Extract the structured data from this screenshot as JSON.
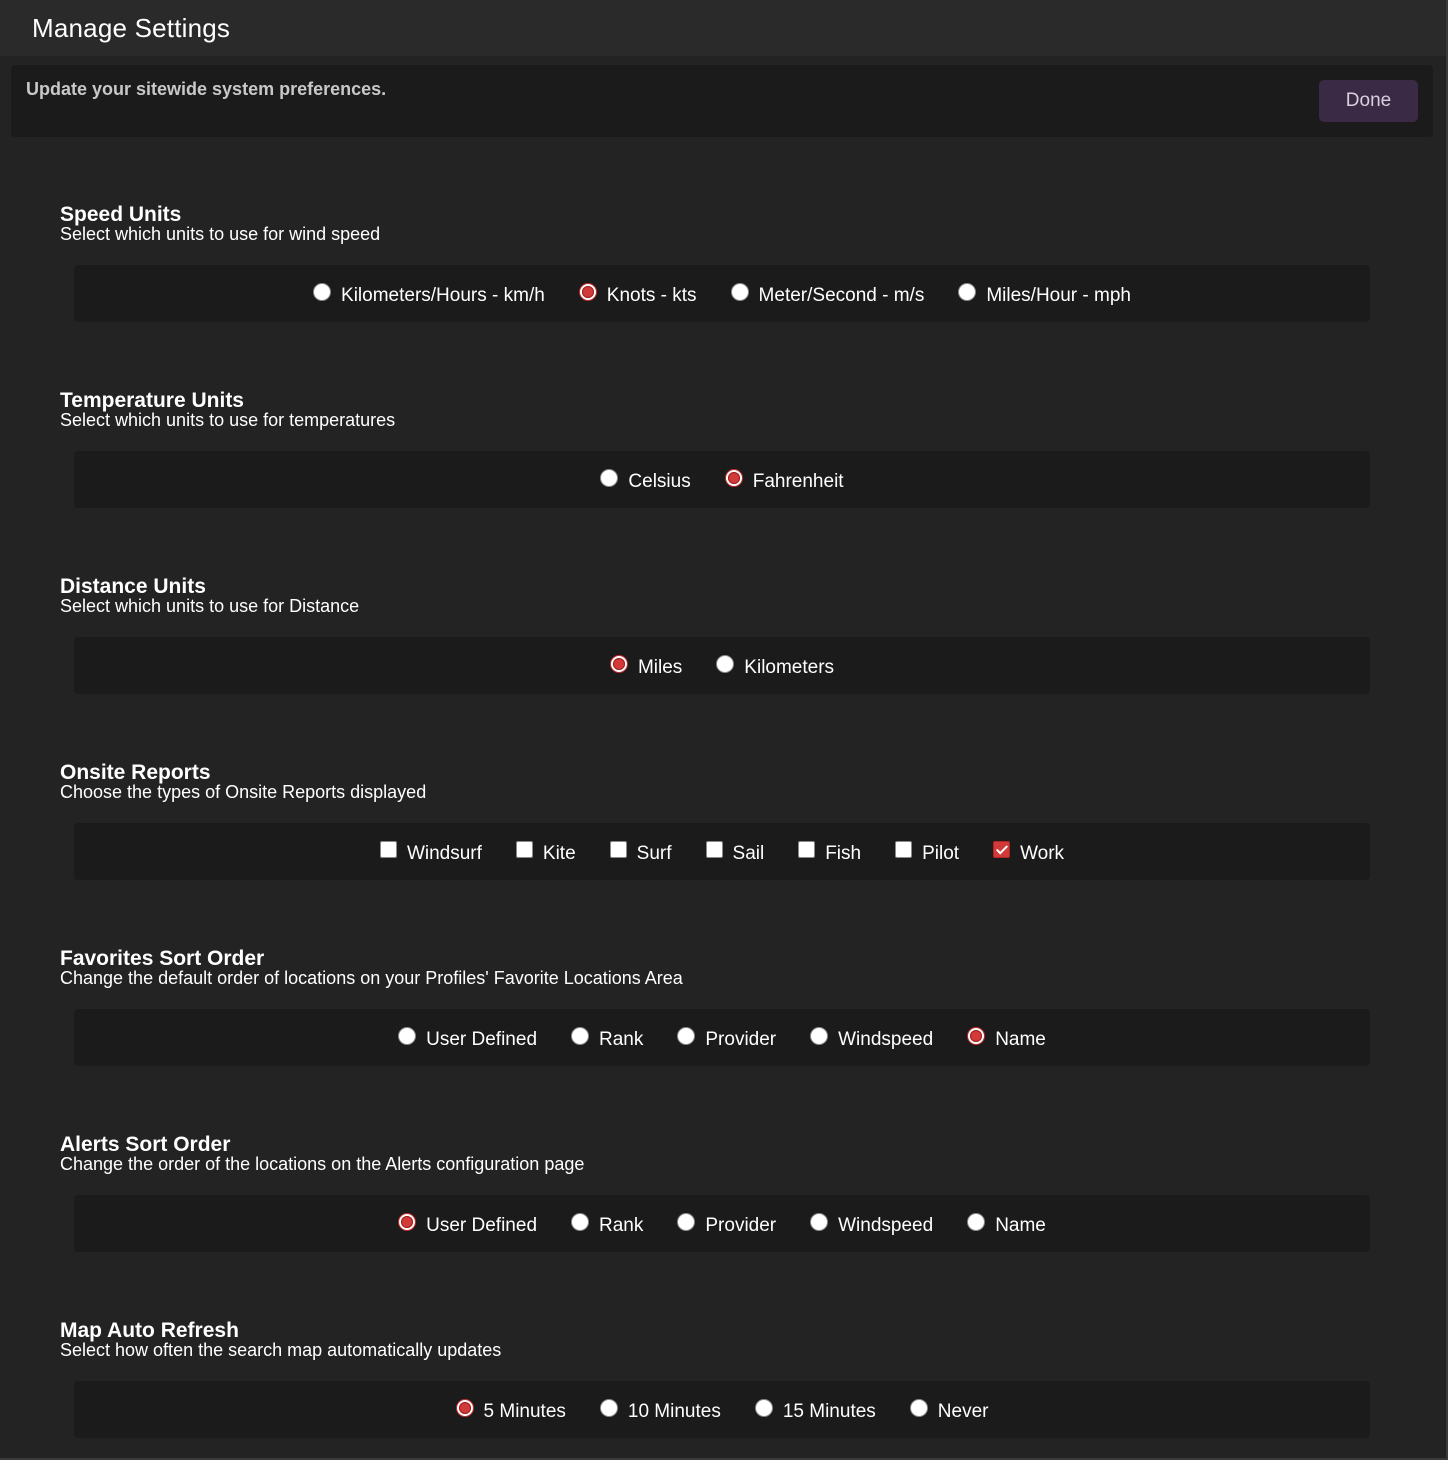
{
  "window": {
    "title": "Manage Settings"
  },
  "header": {
    "description": "Update your sitewide system preferences.",
    "done_label": "Done"
  },
  "colors": {
    "accent": "#d23a3a",
    "done_button": "#3a2a45",
    "panel": "#1b1b1b",
    "background": "#232323"
  },
  "sections": [
    {
      "title": "Speed Units",
      "subtitle": "Select which units to use for wind speed",
      "type": "radio",
      "options": [
        {
          "label": "Kilometers/Hours - km/h",
          "checked": false
        },
        {
          "label": "Knots - kts",
          "checked": true
        },
        {
          "label": "Meter/Second - m/s",
          "checked": false
        },
        {
          "label": "Miles/Hour - mph",
          "checked": false
        }
      ]
    },
    {
      "title": "Temperature Units",
      "subtitle": "Select which units to use for temperatures",
      "type": "radio",
      "options": [
        {
          "label": "Celsius",
          "checked": false
        },
        {
          "label": "Fahrenheit",
          "checked": true
        }
      ]
    },
    {
      "title": "Distance Units",
      "subtitle": "Select which units to use for Distance",
      "type": "radio",
      "options": [
        {
          "label": "Miles",
          "checked": true
        },
        {
          "label": "Kilometers",
          "checked": false
        }
      ]
    },
    {
      "title": "Onsite Reports",
      "subtitle": "Choose the types of Onsite Reports displayed",
      "type": "checkbox",
      "options": [
        {
          "label": "Windsurf",
          "checked": false
        },
        {
          "label": "Kite",
          "checked": false
        },
        {
          "label": "Surf",
          "checked": false
        },
        {
          "label": "Sail",
          "checked": false
        },
        {
          "label": "Fish",
          "checked": false
        },
        {
          "label": "Pilot",
          "checked": false
        },
        {
          "label": "Work",
          "checked": true
        }
      ]
    },
    {
      "title": "Favorites Sort Order",
      "subtitle": "Change the default order of locations on your Profiles' Favorite Locations Area",
      "type": "radio",
      "options": [
        {
          "label": "User Defined",
          "checked": false
        },
        {
          "label": "Rank",
          "checked": false
        },
        {
          "label": "Provider",
          "checked": false
        },
        {
          "label": "Windspeed",
          "checked": false
        },
        {
          "label": "Name",
          "checked": true
        }
      ]
    },
    {
      "title": "Alerts Sort Order",
      "subtitle": "Change the order of the locations on the Alerts configuration page",
      "type": "radio",
      "options": [
        {
          "label": "User Defined",
          "checked": true
        },
        {
          "label": "Rank",
          "checked": false
        },
        {
          "label": "Provider",
          "checked": false
        },
        {
          "label": "Windspeed",
          "checked": false
        },
        {
          "label": "Name",
          "checked": false
        }
      ]
    },
    {
      "title": "Map Auto Refresh",
      "subtitle": "Select how often the search map automatically updates",
      "type": "radio",
      "options": [
        {
          "label": "5 Minutes",
          "checked": true
        },
        {
          "label": "10 Minutes",
          "checked": false
        },
        {
          "label": "15 Minutes",
          "checked": false
        },
        {
          "label": "Never",
          "checked": false
        }
      ]
    }
  ]
}
